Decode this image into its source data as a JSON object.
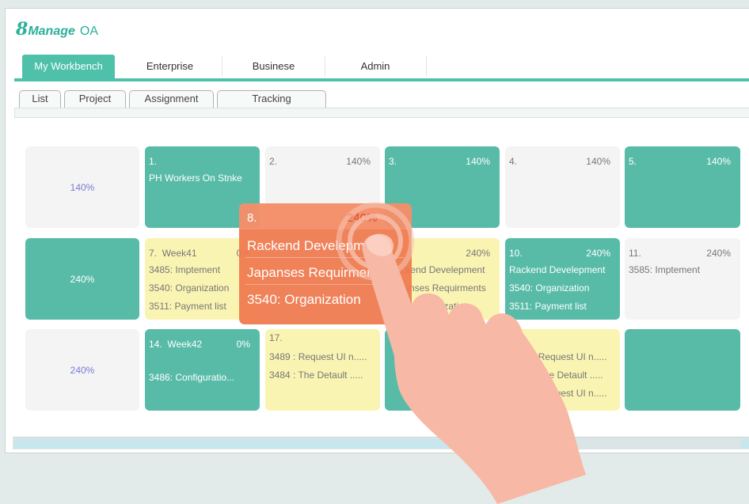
{
  "app": {
    "logo_number": "8",
    "logo_word": "Manage",
    "logo_suffix": "OA"
  },
  "main_tabs": [
    "My Workbench",
    "Enterprise",
    "Businese",
    "Admin"
  ],
  "sub_tabs": [
    "List",
    "Project",
    "Assignment",
    "Tracking"
  ],
  "rows": [
    {
      "label": "140%",
      "cells": [
        {
          "num": "1.",
          "pct": "",
          "lines": [
            "PH Workers On Stnke"
          ]
        },
        {
          "num": "2.",
          "pct": "140%",
          "lines": []
        },
        {
          "num": "3.",
          "pct": "140%",
          "lines": []
        },
        {
          "num": "4.",
          "pct": "140%",
          "lines": []
        },
        {
          "num": "5.",
          "pct": "140%",
          "lines": []
        }
      ]
    },
    {
      "label": "240%",
      "cells": [
        {
          "num": "7.",
          "week": "Week41",
          "pct": "0%",
          "lines": [
            "3485: Imptement",
            "3540: Organization",
            "3511: Payment list"
          ]
        },
        {
          "num": "",
          "pct": "240%",
          "lines": [
            "Rackend Develepment",
            "Japanses Requirments",
            "3540: Organization"
          ]
        },
        {
          "num": "10.",
          "pct": "240%",
          "lines": [
            "Rackend Develepment",
            "3540: Organization",
            "3511: Payment list"
          ]
        },
        {
          "num": "11.",
          "pct": "240%",
          "lines": [
            "3585: Imptement"
          ]
        }
      ]
    },
    {
      "label": "240%",
      "cells": [
        {
          "num": "14.",
          "week": "Week42",
          "pct": "0%",
          "lines": [
            "3486: Configuratio..."
          ]
        },
        {
          "num": "17.",
          "pct": "",
          "lines": [
            "3489 : Request UI n.....",
            "3484 : The Detault ....."
          ]
        },
        {
          "num": "",
          "pct": "",
          "lines": []
        },
        {
          "num": "",
          "pct": "",
          "lines": [
            "3489 : Request UI n.....",
            "3484 : The Detault .....",
            "3489 : Request UI n....."
          ]
        },
        {
          "num": "",
          "pct": "",
          "lines": []
        }
      ]
    }
  ],
  "drag_card": {
    "num": "8.",
    "pct": "240%",
    "lines": [
      "Rackend Develepment",
      "Japanses Requirments",
      "3540: Organization"
    ]
  },
  "colors": {
    "accent": "#4fc1aa",
    "card_green": "#58bba8",
    "card_yellow": "#faf4b3",
    "card_gray": "#f4f4f4",
    "drag_orange": "#ef784e",
    "hand": "#f7b8a6"
  },
  "icons": {
    "pointer": "hand-pointer-icon"
  }
}
